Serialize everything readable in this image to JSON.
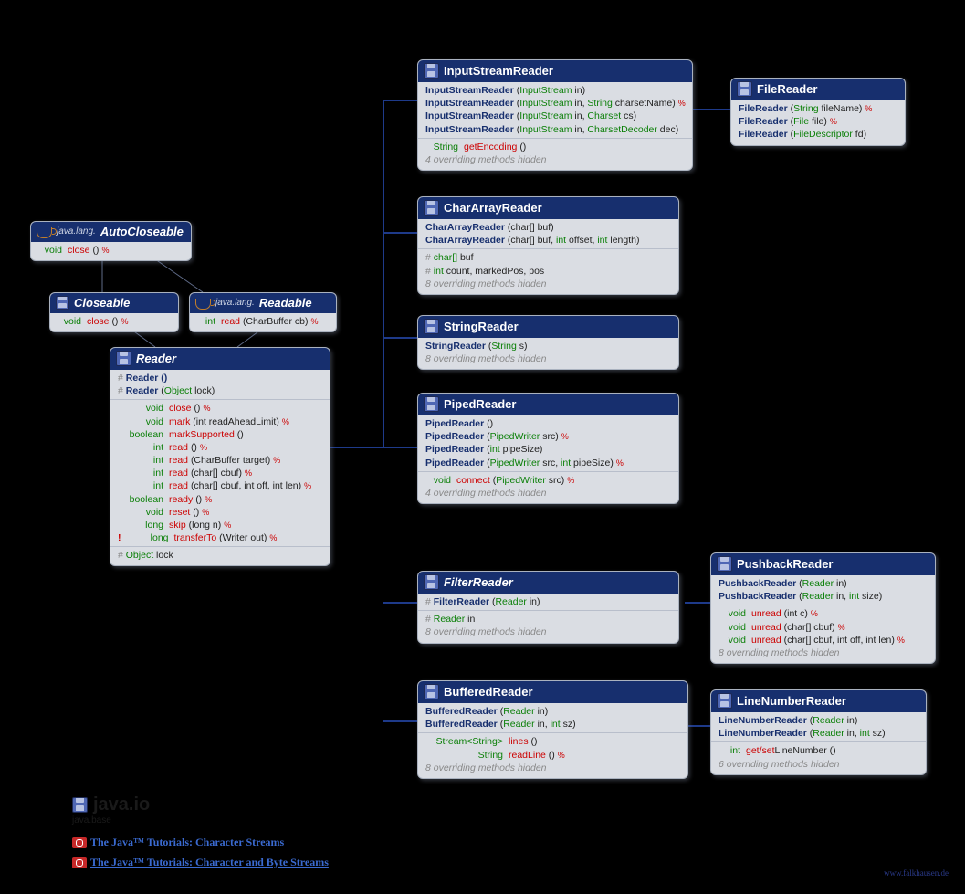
{
  "autoCloseable": {
    "pkg": "java.lang.",
    "title": "AutoCloseable",
    "m1": {
      "ret": "void",
      "name": "close",
      "params": "()",
      "throws": true
    }
  },
  "closeable": {
    "title": "Closeable",
    "m1": {
      "ret": "void",
      "name": "close",
      "params": "()",
      "throws": true
    }
  },
  "readable": {
    "pkg": "java.lang.",
    "title": "Readable",
    "m1": {
      "ret": "int",
      "name": "read",
      "params": "(CharBuffer cb)",
      "throws": true
    }
  },
  "reader": {
    "title": "Reader",
    "c1": "Reader ()",
    "c2": "Reader (Object lock)",
    "m": [
      {
        "ret": "void",
        "name": "close",
        "params": "()",
        "throws": true
      },
      {
        "ret": "void",
        "name": "mark",
        "params": "(int readAheadLimit)",
        "throws": true
      },
      {
        "ret": "boolean",
        "name": "markSupported",
        "params": "()"
      },
      {
        "ret": "int",
        "name": "read",
        "params": "()",
        "throws": true
      },
      {
        "ret": "int",
        "name": "read",
        "params": "(CharBuffer target)",
        "throws": true
      },
      {
        "ret": "int",
        "name": "read",
        "params": "(char[] cbuf)",
        "throws": true
      },
      {
        "ret": "int",
        "name": "read",
        "params": "(char[] cbuf, int off, int len)",
        "throws": true
      },
      {
        "ret": "boolean",
        "name": "ready",
        "params": "()",
        "throws": true
      },
      {
        "ret": "void",
        "name": "reset",
        "params": "()",
        "throws": true
      },
      {
        "ret": "long",
        "name": "skip",
        "params": "(long n)",
        "throws": true
      },
      {
        "bang": true,
        "ret": "long",
        "name": "transferTo",
        "params": "(Writer out)",
        "throws": true
      }
    ],
    "field": "Object lock"
  },
  "isr": {
    "title": "InputStreamReader",
    "c": [
      "InputStreamReader (InputStream in)",
      "InputStreamReader (InputStream in, String charsetName) %",
      "InputStreamReader (InputStream in, Charset cs)",
      "InputStreamReader (InputStream in, CharsetDecoder dec)"
    ],
    "m1": {
      "ret": "String",
      "name": "getEncoding",
      "params": "()"
    },
    "note": "4 overriding methods hidden"
  },
  "fileReader": {
    "title": "FileReader",
    "c": [
      "FileReader (String fileName) %",
      "FileReader (File file) %",
      "FileReader (FileDescriptor fd)"
    ]
  },
  "car": {
    "title": "CharArrayReader",
    "c": [
      "CharArrayReader (char[] buf)",
      "CharArrayReader (char[] buf, int offset, int length)"
    ],
    "fields": [
      "char[] buf",
      "int count, markedPos, pos"
    ],
    "note": "8 overriding methods hidden"
  },
  "sr": {
    "title": "StringReader",
    "c": [
      "StringReader (String s)"
    ],
    "note": "8 overriding methods hidden"
  },
  "pr": {
    "title": "PipedReader",
    "c": [
      "PipedReader ()",
      "PipedReader (PipedWriter src) %",
      "PipedReader (int pipeSize)",
      "PipedReader (PipedWriter src, int pipeSize) %"
    ],
    "m1": {
      "ret": "void",
      "name": "connect",
      "params": "(PipedWriter src)",
      "throws": true
    },
    "note": "4 overriding methods hidden"
  },
  "fr": {
    "title": "FilterReader",
    "c": [
      "FilterReader (Reader in)"
    ],
    "field": "Reader in",
    "note": "8 overriding methods hidden"
  },
  "pb": {
    "title": "PushbackReader",
    "c": [
      "PushbackReader (Reader in)",
      "PushbackReader (Reader in, int size)"
    ],
    "m": [
      {
        "ret": "void",
        "name": "unread",
        "params": "(int c)",
        "throws": true
      },
      {
        "ret": "void",
        "name": "unread",
        "params": "(char[] cbuf)",
        "throws": true
      },
      {
        "ret": "void",
        "name": "unread",
        "params": "(char[] cbuf, int off, int len)",
        "throws": true
      }
    ],
    "note": "8 overriding methods hidden"
  },
  "br": {
    "title": "BufferedReader",
    "c": [
      "BufferedReader (Reader in)",
      "BufferedReader (Reader in, int sz)"
    ],
    "m": [
      {
        "ret": "Stream<String>",
        "name": "lines",
        "params": "()"
      },
      {
        "ret": "String",
        "name": "readLine",
        "params": "()",
        "throws": true
      }
    ],
    "note": "8 overriding methods hidden"
  },
  "lnr": {
    "title": "LineNumberReader",
    "c": [
      "LineNumberReader (Reader in)",
      "LineNumberReader (Reader in, int sz)"
    ],
    "m1": {
      "ret": "int",
      "name": "get/setLineNumber",
      "params": "()"
    },
    "note": "6 overriding methods hidden"
  },
  "pkg": {
    "title": "java.io",
    "sub": "java.base"
  },
  "links": [
    "The Java™ Tutorials: Character Streams",
    "The Java™ Tutorials: Character and Byte Streams"
  ],
  "watermark": "www.falkhausen.de"
}
